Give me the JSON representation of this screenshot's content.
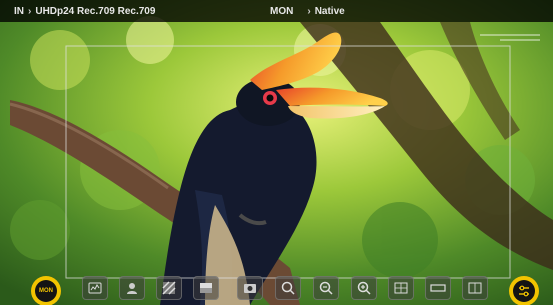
{
  "status_bar": {
    "input_label": "IN",
    "input_format": "UHDp24 Rec.709 Rec.709",
    "mode_label": "MON",
    "lut_label": "Native"
  },
  "toolbar": {
    "mode_button_label": "MON",
    "tools": [
      {
        "icon": "waveform-icon"
      },
      {
        "icon": "false-color-icon"
      },
      {
        "icon": "zebra-icon"
      },
      {
        "icon": "lut-icon"
      },
      {
        "icon": "focus-peaking-icon"
      },
      {
        "icon": "zoom-icon"
      },
      {
        "icon": "zoom-out-icon"
      },
      {
        "icon": "zoom-in-icon"
      },
      {
        "icon": "frame-guides-icon"
      },
      {
        "icon": "anamorphic-icon"
      },
      {
        "icon": "safe-area-icon"
      }
    ],
    "menu_icon": "sliders-icon",
    "accent_color": "#f2c400"
  }
}
